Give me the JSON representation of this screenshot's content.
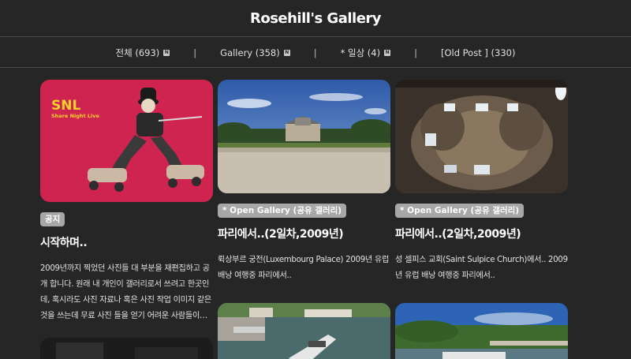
{
  "header": {
    "title": "Rosehill's Gallery"
  },
  "nav": {
    "items": [
      {
        "label": "전체 (693)",
        "badge": "N"
      },
      {
        "label": "Gallery (358)",
        "badge": "N"
      },
      {
        "label": "* 일상 (4)",
        "badge": "N"
      },
      {
        "label": "[Old Post ] (330)",
        "badge": ""
      }
    ],
    "separator": "|"
  },
  "posts": [
    {
      "tag": "공지",
      "title": "시작하며..",
      "description": "2009년까지 찍었던 사진들 대 부분을 재편집하고 공개 합니다. 원래 내 개인이 갤러리로서 쓰려고 한곳인데, 혹시라도 사진 자료나 혹은 사진 작업 이미지 같은 것을 쓰는데 무료 사진 들을 얻기 어려운 사람들이…",
      "thumb_text": {
        "big": "SNL",
        "small": "Share Night Live"
      }
    },
    {
      "tag": "* Open Gallery (공유 갤러리)",
      "title": "파리에서..(2일차,2009년)",
      "description": "뤽상부르 궁전(Luxembourg Palace) 2009년 유럽 배낭 여행중 파리에서.."
    },
    {
      "tag": "* Open Gallery (공유 갤러리)",
      "title": "파리에서..(2일차,2009년)",
      "description": "성 셀피스 교회(Saint Sulpice Church)에서.. 2009년 유럽 배낭 여행중 파리에서.."
    }
  ],
  "colors": {
    "background": "#262626",
    "tag": "#a7a7a7",
    "snl_background": "#cf2350",
    "snl_text": "#f5d22b"
  }
}
